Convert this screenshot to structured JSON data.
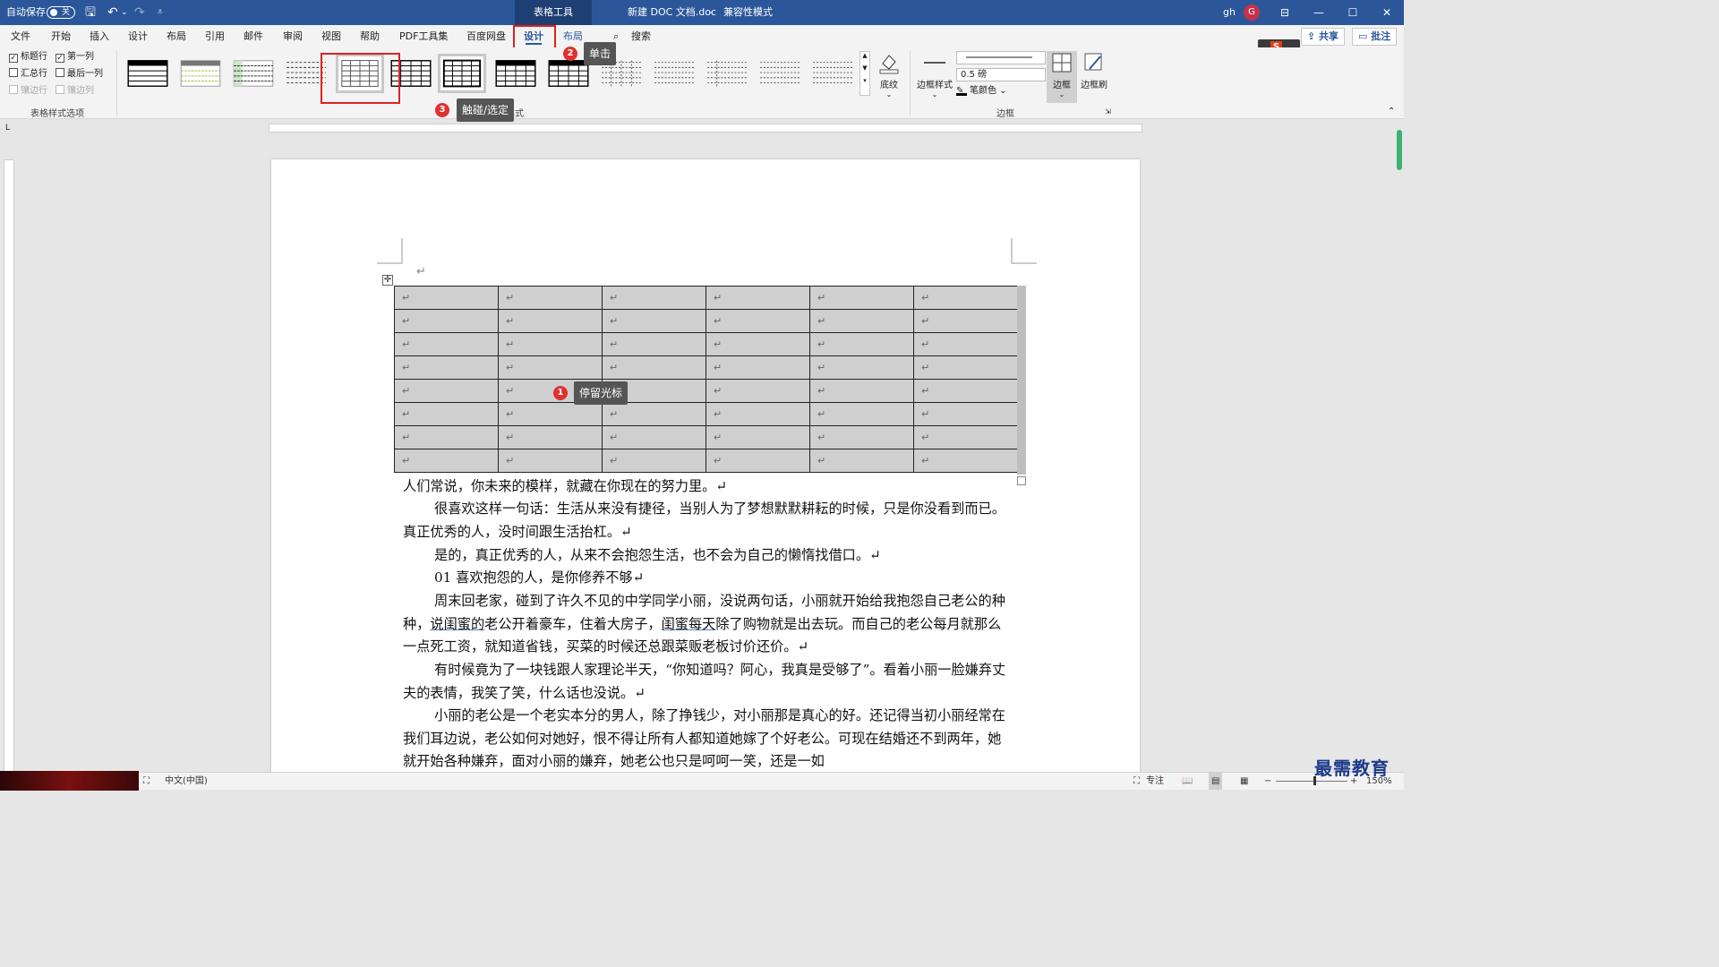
{
  "titlebar": {
    "autosave_label": "自动保存",
    "autosave_state": "关",
    "tool_tab": "表格工具",
    "doc_title": "新建 DOC 文档.doc",
    "mode": "兼容性模式",
    "user": "gh",
    "avatar": "G"
  },
  "tabs": {
    "file": "文件",
    "home": "开始",
    "insert": "插入",
    "design1": "设计",
    "layout1": "布局",
    "references": "引用",
    "mailings": "邮件",
    "review": "审阅",
    "view": "视图",
    "help": "帮助",
    "pdf": "PDF工具集",
    "baidu": "百度网盘",
    "design": "设计",
    "layout": "布局",
    "search": "搜索",
    "share": "共享",
    "comments": "批注"
  },
  "ribbon": {
    "opt_header_row": "标题行",
    "opt_first_col": "第一列",
    "opt_total_row": "汇总行",
    "opt_last_col": "最后一列",
    "opt_banded_rows": "镶边行",
    "opt_banded_cols": "镶边列",
    "grp_style_options": "表格样式选项",
    "grp_styles_partial": "样式",
    "shading": "底纹",
    "border_styles": "边框样式",
    "weight": "0.5 磅",
    "pen_color": "笔颜色",
    "borders": "边框",
    "border_painter": "边框刷",
    "grp_borders": "边框"
  },
  "callouts": {
    "c1_num": "1",
    "c1": "停留光标",
    "c2_num": "2",
    "c2": "单击",
    "c3_num": "3",
    "c3": "触碰/选定"
  },
  "table": {
    "mark": "↵"
  },
  "doc": {
    "empty_mark": "↵",
    "p1": "人们常说，你未来的模样，就藏在你现在的努力里。↵",
    "p2": "很喜欢这样一句话：生活从来没有捷径，当别人为了梦想默默耕耘的时候，只是你没看到而已。真正优秀的人，没时间跟生活抬杠。↵",
    "p3": "是的，真正优秀的人，从来不会抱怨生活，也不会为自己的懒惰找借口。↵",
    "p4": "01  喜欢抱怨的人，是你修养不够↵",
    "p5a": "周末回老家，碰到了许久不见的中学同学小丽，没说两句话，小丽就开始给我抱怨自己老公的种种，",
    "p5u1": "说闺蜜的",
    "p5b": "老公开着豪车，住着大房子，",
    "p5u2": "闺蜜每天",
    "p5c": "除了购物就是出去玩。而自己的老公每月就那么一点死工资，就知道省钱，买菜的时候还总跟菜贩老板讨价还价。↵",
    "p6": "有时候竟为了一块钱跟人家理论半天，“你知道吗？阿心，我真是受够了”。看着小丽一脸嫌弃丈夫的表情，我笑了笑，什么话也没说。↵",
    "p7": "小丽的老公是一个老实本分的男人，除了挣钱少，对小丽那是真心的好。还记得当初小丽经常在我们耳边说，老公如何对她好，恨不得让所有人都知道她嫁了个好老公。可现在结婚还不到两年，她就开始各种嫌弃，面对小丽的嫌弃，她老公也只是呵呵一笑，还是一如"
  },
  "status": {
    "lang": "中文(中国)",
    "focus": "专注",
    "zoom": "150%"
  },
  "watermark": "最需教育"
}
